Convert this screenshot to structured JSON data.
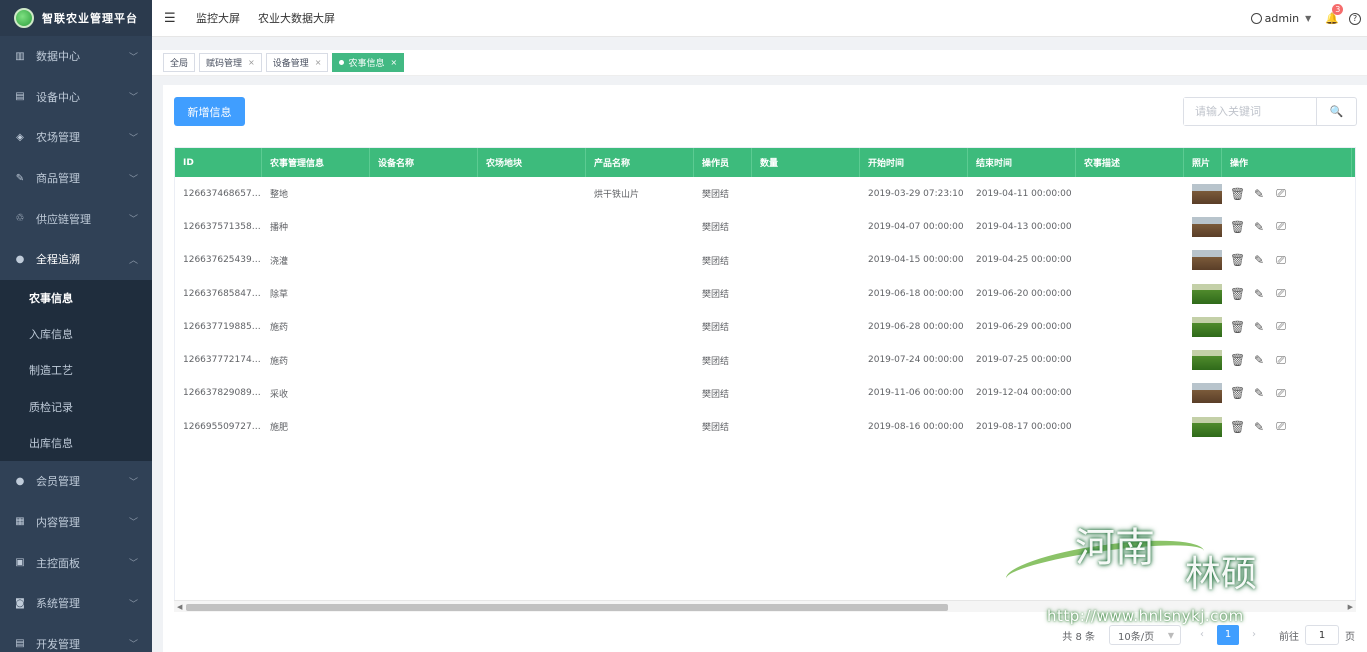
{
  "app": {
    "title": "智联农业管理平台"
  },
  "sidebar": {
    "items_top": [
      {
        "label": "数据中心",
        "icon": "chart-icon"
      },
      {
        "label": "设备中心",
        "icon": "device-icon"
      },
      {
        "label": "农场管理",
        "icon": "farm-icon"
      },
      {
        "label": "商品管理",
        "icon": "goods-icon"
      },
      {
        "label": "供应链管理",
        "icon": "supply-icon"
      },
      {
        "label": "全程追溯",
        "icon": "trace-icon"
      }
    ],
    "submenu": [
      "农事信息",
      "入库信息",
      "制造工艺",
      "质检记录",
      "出库信息"
    ],
    "items_bottom": [
      {
        "label": "会员管理",
        "icon": "member-icon"
      },
      {
        "label": "内容管理",
        "icon": "content-icon"
      },
      {
        "label": "主控面板",
        "icon": "panel-icon"
      },
      {
        "label": "系统管理",
        "icon": "system-icon"
      },
      {
        "label": "开发管理",
        "icon": "dev-icon"
      }
    ]
  },
  "topbar": {
    "links": [
      "监控大屏",
      "农业大数据大屏"
    ],
    "user": "admin",
    "notifications": "3"
  },
  "tags": [
    "全局",
    "赋码管理",
    "设备管理",
    "农事信息"
  ],
  "toolbar": {
    "add_label": "新增信息",
    "search_placeholder": "请输入关键词"
  },
  "table": {
    "headers": [
      "ID",
      "农事管理信息",
      "设备名称",
      "农场地块",
      "产品名称",
      "操作员",
      "数量",
      "开始时间",
      "结束时间",
      "农事描述",
      "照片",
      "操作"
    ],
    "rows": [
      {
        "id": "1266374686577...",
        "info": "整地",
        "device": "",
        "plot": "",
        "product": "烘干铁山片",
        "operator": "樊团结",
        "qty": "",
        "start": "2019-03-29 07:23:10",
        "end": "2019-04-11 00:00:00",
        "desc": "",
        "photo": "brown"
      },
      {
        "id": "1266375713581...",
        "info": "播种",
        "device": "",
        "plot": "",
        "product": "",
        "operator": "樊团结",
        "qty": "",
        "start": "2019-04-07 00:00:00",
        "end": "2019-04-13 00:00:00",
        "desc": "",
        "photo": "brown"
      },
      {
        "id": "1266376254399...",
        "info": "浇灌",
        "device": "",
        "plot": "",
        "product": "",
        "operator": "樊团结",
        "qty": "",
        "start": "2019-04-15 00:00:00",
        "end": "2019-04-25 00:00:00",
        "desc": "",
        "photo": "brown"
      },
      {
        "id": "1266376858479...",
        "info": "除草",
        "device": "",
        "plot": "",
        "product": "",
        "operator": "樊团结",
        "qty": "",
        "start": "2019-06-18 00:00:00",
        "end": "2019-06-20 00:00:00",
        "desc": "",
        "photo": "green"
      },
      {
        "id": "1266377198856...",
        "info": "施药",
        "device": "",
        "plot": "",
        "product": "",
        "operator": "樊团结",
        "qty": "",
        "start": "2019-06-28 00:00:00",
        "end": "2019-06-29 00:00:00",
        "desc": "",
        "photo": "green"
      },
      {
        "id": "1266377721747...",
        "info": "施药",
        "device": "",
        "plot": "",
        "product": "",
        "operator": "樊团结",
        "qty": "",
        "start": "2019-07-24 00:00:00",
        "end": "2019-07-25 00:00:00",
        "desc": "",
        "photo": "green"
      },
      {
        "id": "1266378290893...",
        "info": "采收",
        "device": "",
        "plot": "",
        "product": "",
        "operator": "樊团结",
        "qty": "",
        "start": "2019-11-06 00:00:00",
        "end": "2019-12-04 00:00:00",
        "desc": "",
        "photo": "brown"
      },
      {
        "id": "1266955097279...",
        "info": "施肥",
        "device": "",
        "plot": "",
        "product": "",
        "operator": "樊团结",
        "qty": "",
        "start": "2019-08-16 00:00:00",
        "end": "2019-08-17 00:00:00",
        "desc": "",
        "photo": "green"
      }
    ]
  },
  "pagination": {
    "total": "共 8 条",
    "page_size": "10条/页",
    "current": "1",
    "goto_label": "前往",
    "page_suffix": "页",
    "goto_value": "1"
  },
  "watermark": {
    "big1": "河南",
    "big2": "林硕",
    "url": "http://www.hnlsnykj.com"
  },
  "colors": {
    "sidebar_bg": "#304156",
    "accent": "#409eff",
    "table_header": "#3dbb7c",
    "tag_active": "#42b983"
  }
}
